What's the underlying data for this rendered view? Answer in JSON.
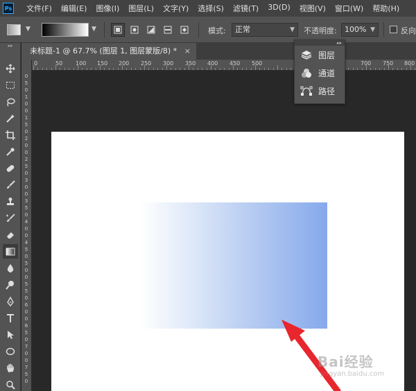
{
  "app": {
    "logo_text": "Ps"
  },
  "menu": [
    "文件(F)",
    "编辑(E)",
    "图像(I)",
    "图层(L)",
    "文字(Y)",
    "选择(S)",
    "滤镜(T)",
    "3D(D)",
    "视图(V)",
    "窗口(W)",
    "帮助(H)"
  ],
  "options": {
    "mode_label": "模式:",
    "mode_value": "正常",
    "opacity_label": "不透明度:",
    "opacity_value": "100%",
    "reverse_label": "反向"
  },
  "document": {
    "tab_title": "未标题-1 @ 67.7% (图层 1, 图层蒙版/8) *",
    "close_glyph": "×"
  },
  "ruler": {
    "top_labels": [
      "0",
      "50",
      "100",
      "150",
      "200",
      "250",
      "300",
      "350",
      "400",
      "450",
      "500",
      "700",
      "750",
      "800"
    ],
    "left_labels": [
      "0",
      "5",
      "0",
      "1",
      "0",
      "0",
      "1",
      "5",
      "0",
      "2",
      "0",
      "0",
      "2",
      "5",
      "0",
      "3",
      "0",
      "0",
      "3",
      "5",
      "0",
      "4",
      "0",
      "0",
      "4",
      "5",
      "0",
      "5",
      "0",
      "0",
      "5",
      "5",
      "0",
      "6",
      "0",
      "0",
      "6",
      "5",
      "0",
      "7",
      "0",
      "0",
      "7",
      "5",
      "0"
    ]
  },
  "panel": {
    "items": [
      {
        "label": "图层",
        "icon": "layers-icon"
      },
      {
        "label": "通道",
        "icon": "channels-icon"
      },
      {
        "label": "路径",
        "icon": "paths-icon"
      }
    ]
  },
  "tools": [
    "move-tool-icon",
    "marquee-tool-icon",
    "lasso-tool-icon",
    "magic-wand-tool-icon",
    "crop-tool-icon",
    "eyedropper-tool-icon",
    "healing-brush-tool-icon",
    "brush-tool-icon",
    "clone-stamp-tool-icon",
    "history-brush-tool-icon",
    "eraser-tool-icon",
    "gradient-tool-icon",
    "blur-tool-icon",
    "dodge-tool-icon",
    "pen-tool-icon",
    "type-tool-icon",
    "path-selection-tool-icon",
    "ellipse-tool-icon",
    "hand-tool-icon",
    "zoom-tool-icon"
  ],
  "watermark": {
    "main": "Bai经验",
    "sub": "jingyan.baidu.com"
  },
  "colors": {
    "gradient_end": "#86a9ec",
    "gradient_start": "#ffffff",
    "arrow": "#e8262d"
  }
}
